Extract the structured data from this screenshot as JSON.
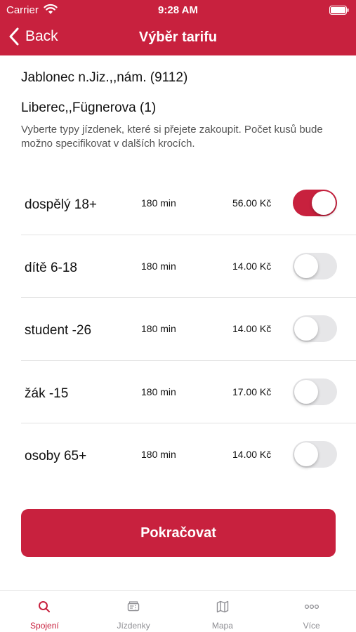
{
  "status_bar": {
    "carrier": "Carrier",
    "time": "9:28 AM"
  },
  "nav": {
    "back_label": "Back",
    "title": "Výběr tarifu"
  },
  "route": {
    "from": "Jablonec n.Jiz.,,nám. (9112)",
    "to": "Liberec,,Fügnerova (1)"
  },
  "hint": "Vyberte typy jízdenek, které si přejete zakoupit. Počet kusů bude možno specifikovat v dalších krocích.",
  "tariffs": [
    {
      "name": "dospělý 18+",
      "duration": "180 min",
      "price": "56.00 Kč",
      "selected": true
    },
    {
      "name": "dítě 6-18",
      "duration": "180 min",
      "price": "14.00 Kč",
      "selected": false
    },
    {
      "name": "student -26",
      "duration": "180 min",
      "price": "14.00 Kč",
      "selected": false
    },
    {
      "name": "žák -15",
      "duration": "180 min",
      "price": "17.00 Kč",
      "selected": false
    },
    {
      "name": "osoby 65+",
      "duration": "180 min",
      "price": "14.00 Kč",
      "selected": false
    }
  ],
  "continue_label": "Pokračovat",
  "tabs": [
    {
      "label": "Spojení",
      "icon": "search-icon",
      "active": true
    },
    {
      "label": "Jízdenky",
      "icon": "ticket-icon",
      "active": false
    },
    {
      "label": "Mapa",
      "icon": "map-icon",
      "active": false
    },
    {
      "label": "Více",
      "icon": "more-icon",
      "active": false
    }
  ],
  "colors": {
    "accent": "#c8213e",
    "inactive": "#8e8e93"
  }
}
